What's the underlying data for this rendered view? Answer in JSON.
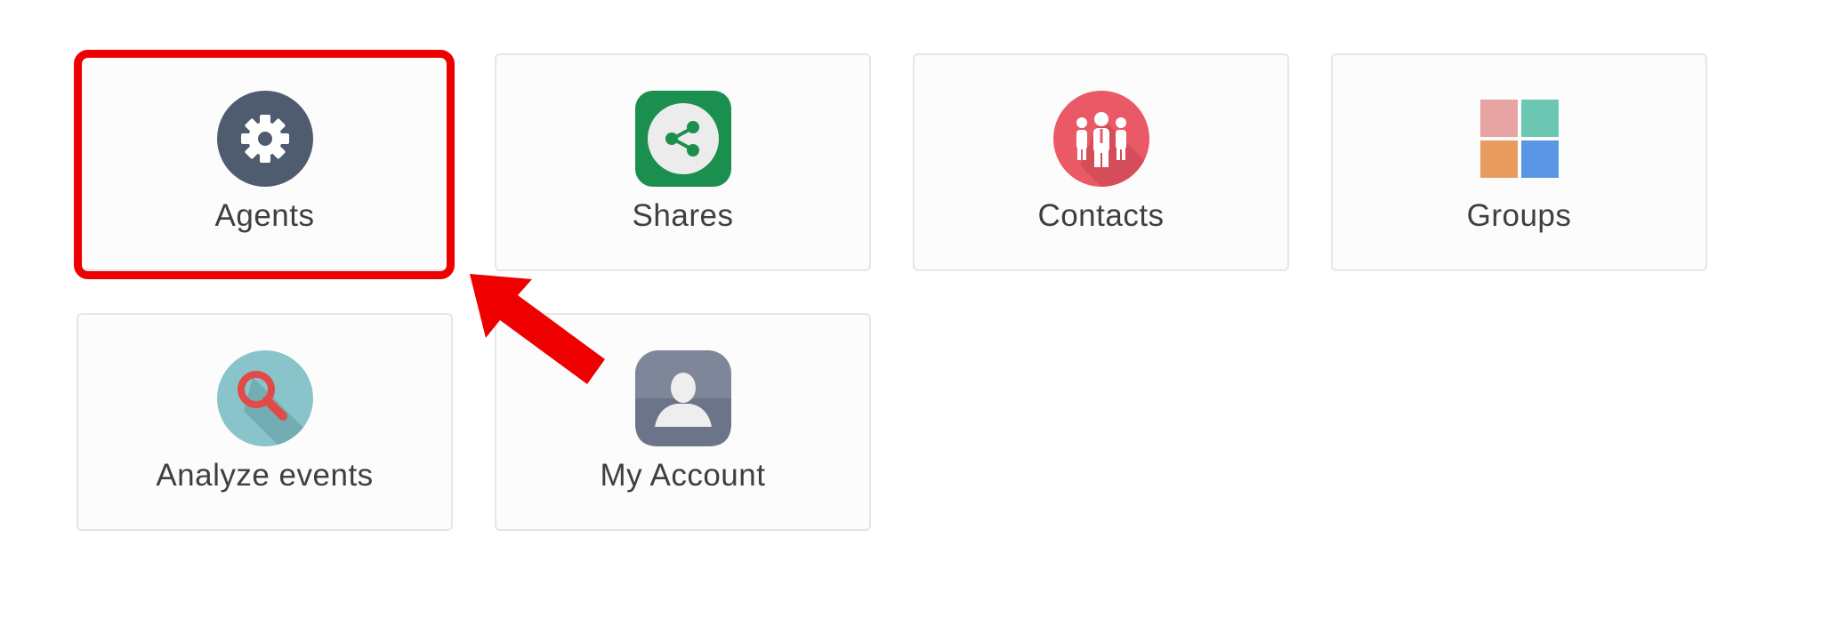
{
  "tiles": [
    {
      "id": "agents",
      "label": "Agents",
      "icon": "gear-icon",
      "color": "#4f5b6e"
    },
    {
      "id": "shares",
      "label": "Shares",
      "icon": "share-icon",
      "color": "#1b8f4d"
    },
    {
      "id": "contacts",
      "label": "Contacts",
      "icon": "people-icon",
      "color": "#e95a66"
    },
    {
      "id": "groups",
      "label": "Groups",
      "icon": "grid-squares-icon",
      "colors": [
        "#e8a3a3",
        "#6cc7b2",
        "#e89c60",
        "#5a96e3"
      ]
    },
    {
      "id": "analyze",
      "label": "Analyze events",
      "icon": "magnifier-icon",
      "color": "#8ac4cb"
    },
    {
      "id": "account",
      "label": "My Account",
      "icon": "user-silhouette-icon",
      "color": "#7d8799"
    }
  ],
  "annotation": {
    "highlight_color": "#ee0000",
    "highlight_target": "agents",
    "arrow_icon": "red-arrow-icon"
  }
}
